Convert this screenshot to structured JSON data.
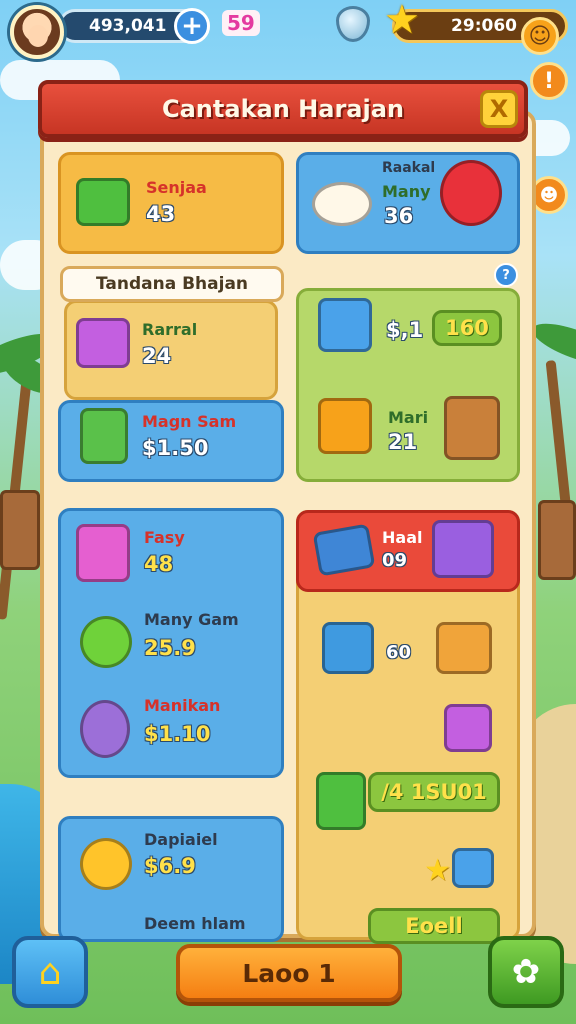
{
  "hud": {
    "coins": "493,041",
    "add_label": "+",
    "gems": "59",
    "stars": "29:060"
  },
  "panel": {
    "title": "Cantakan Harajan",
    "close_label": "X",
    "sub_header": "Tandana Bhajan",
    "help_label": "?"
  },
  "items": [
    {
      "label": "Senjaa",
      "value": "43"
    },
    {
      "label_top": "Raakal",
      "label": "Many",
      "value": "36"
    },
    {
      "label": "Rarral",
      "value": "24"
    },
    {
      "label": "Magn Sam",
      "value": "$1.50"
    },
    {
      "value": "$,1",
      "chip": "160"
    },
    {
      "label": "Mari",
      "value": "21"
    },
    {
      "label": "Fasy",
      "value": "48"
    },
    {
      "label": "Many Gam",
      "value": "25.9"
    },
    {
      "label": "Manikan",
      "value": "$1.10"
    },
    {
      "label": "Haal",
      "value": "09"
    },
    {
      "value": "60"
    },
    {
      "chip": "/4 1SU01"
    },
    {
      "label": "Dapiaiel",
      "value": "$6.9"
    },
    {
      "label": "Deem hlam"
    },
    {
      "chip": "Eoell"
    }
  ],
  "bottom": {
    "main_label": "Laoo 1"
  }
}
